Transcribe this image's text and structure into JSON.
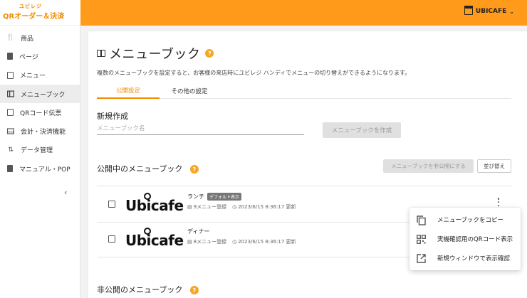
{
  "header": {
    "logo_top": "ユビレジ",
    "logo_main": "QRオーダー＆決済",
    "store_name": "UBICAFE"
  },
  "sidebar": {
    "items": [
      {
        "label": "商品",
        "icon": "utensils-icon"
      },
      {
        "label": "ページ",
        "icon": "page-icon"
      },
      {
        "label": "メニュー",
        "icon": "menu-icon"
      },
      {
        "label": "メニューブック",
        "icon": "menubook-icon",
        "active": true
      },
      {
        "label": "QRコード伝票",
        "icon": "qr-slip-icon"
      },
      {
        "label": "会計・決済機能",
        "icon": "payment-icon"
      },
      {
        "label": "データ管理",
        "icon": "data-transfer-icon"
      },
      {
        "label": "マニュアル・POP",
        "icon": "manual-icon"
      }
    ],
    "collapse": "‹"
  },
  "main": {
    "title": "メニューブック",
    "help": "?",
    "description": "複数のメニューブックを設定すると、お客様の来店時にユビレジ ハンディでメニューの切り替えができるようになります。",
    "tabs": [
      {
        "label": "公開設定",
        "active": true
      },
      {
        "label": "その他の設定",
        "active": false
      }
    ],
    "create": {
      "heading": "新規作成",
      "placeholder": "メニューブック名",
      "button": "メニューブックを作成"
    },
    "published": {
      "heading": "公開中のメニューブック",
      "unpublish_button": "メニューブックを非公開にする",
      "sort_button": "並び替え",
      "books": [
        {
          "brand": "Ubicafe",
          "name": "ランチ",
          "badge": "デフォルト表示",
          "count": "9メニュー登録",
          "updated": "2023/6/15 8:36:17 更新"
        },
        {
          "brand": "Ubicafe",
          "name": "ディナー",
          "badge": "",
          "count": "8メニュー登録",
          "updated": "2023/6/15 8:36:17 更新"
        }
      ]
    },
    "unpublished": {
      "heading": "非公開のメニューブック"
    }
  },
  "popup_menu": {
    "items": [
      {
        "label": "メニューブックをコピー",
        "icon": "copy-icon"
      },
      {
        "label": "実機確認用のQRコード表示",
        "icon": "qr-code-icon"
      },
      {
        "label": "新規ウィンドウで表示確認",
        "icon": "open-in-new-icon"
      }
    ]
  },
  "colors": {
    "accent": "#ff9a1a",
    "accent_text": "#f28b00",
    "help": "#f5a623"
  }
}
